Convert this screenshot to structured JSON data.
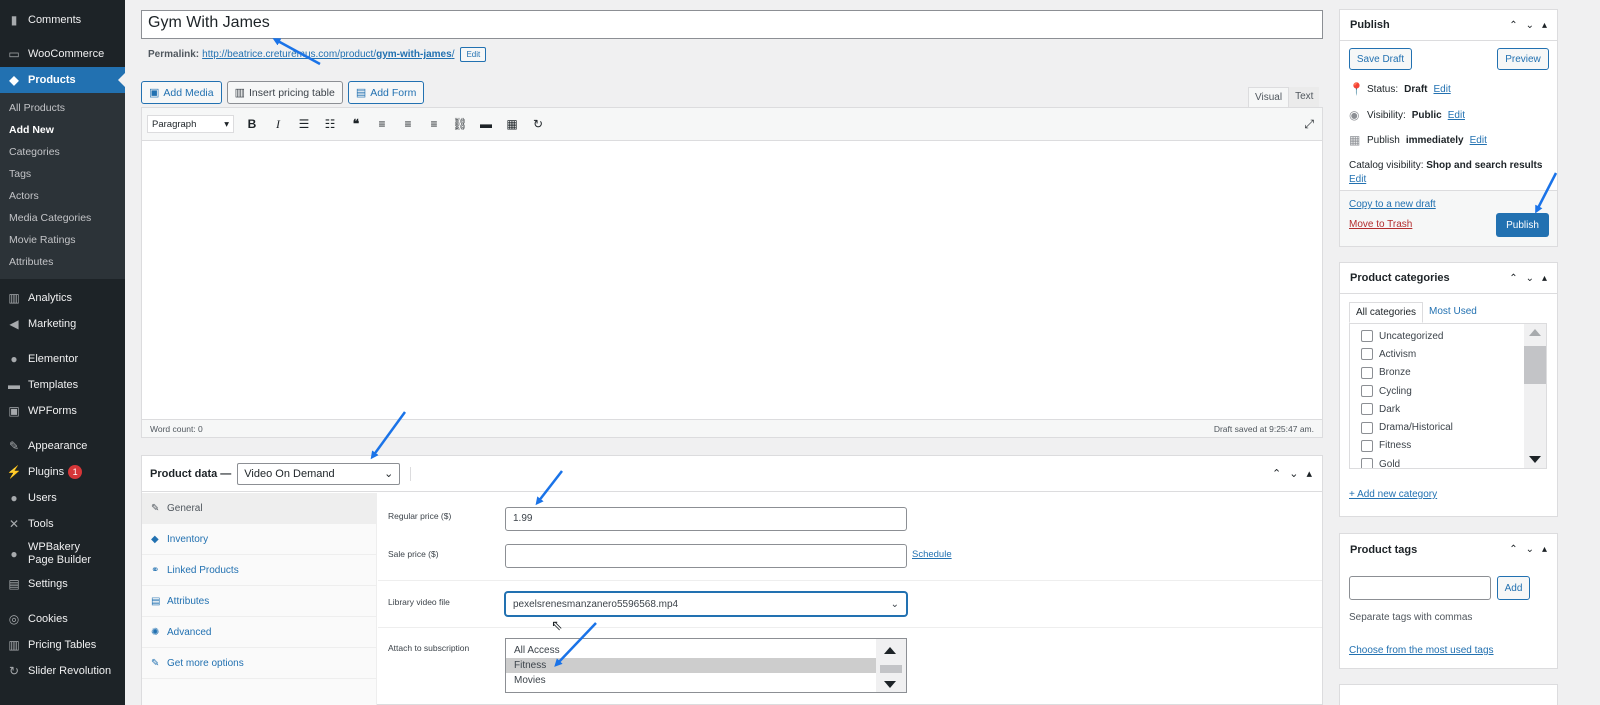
{
  "sidebar": {
    "items": [
      {
        "label": "Comments",
        "icon": "comment-icon"
      },
      {
        "label": "WooCommerce",
        "icon": "woo-icon"
      },
      {
        "label": "Products",
        "icon": "products-icon"
      }
    ],
    "products_submenu": [
      "All Products",
      "Add New",
      "Categories",
      "Tags",
      "Actors",
      "Media Categories",
      "Movie Ratings",
      "Attributes"
    ],
    "lower_items": [
      {
        "label": "Analytics"
      },
      {
        "label": "Marketing"
      },
      {
        "label": "Elementor"
      },
      {
        "label": "Templates"
      },
      {
        "label": "WPForms"
      },
      {
        "label": "Appearance"
      },
      {
        "label": "Plugins",
        "badge": "1"
      },
      {
        "label": "Users"
      },
      {
        "label": "Tools"
      },
      {
        "label": "WPBakery Page Builder"
      },
      {
        "label": "Settings"
      },
      {
        "label": "Cookies"
      },
      {
        "label": "Pricing Tables"
      },
      {
        "label": "Slider Revolution"
      }
    ]
  },
  "editor": {
    "title_value": "Gym With James",
    "permalink_label": "Permalink:",
    "permalink_base": "http://beatrice.creturemus.com/product/",
    "permalink_slug": "gym-with-james",
    "permalink_tail": "/",
    "permalink_edit": "Edit",
    "buttons": {
      "add_media": "Add Media",
      "insert_pricing": "Insert pricing table",
      "add_form": "Add Form"
    },
    "tabs": {
      "visual": "Visual",
      "text": "Text"
    },
    "format": "Paragraph",
    "word_count": "Word count: 0",
    "draft_saved": "Draft saved at 9:25:47 am."
  },
  "product_data": {
    "label": "Product data —",
    "type": "Video On Demand",
    "tabs": [
      "General",
      "Inventory",
      "Linked Products",
      "Attributes",
      "Advanced",
      "Get more options"
    ],
    "regular_price_label": "Regular price ($)",
    "regular_price": "1.99",
    "sale_price_label": "Sale price ($)",
    "sale_price": "",
    "schedule": "Schedule",
    "video_label": "Library video file",
    "video_file": "pexelsrenesmanzanero5596568.mp4",
    "subscription_label": "Attach to subscription",
    "subscription_options": [
      "All Access",
      "Fitness",
      "Movies"
    ],
    "selected_option": "Fitness"
  },
  "publish": {
    "title": "Publish",
    "save_draft": "Save Draft",
    "preview": "Preview",
    "status_label": "Status:",
    "status_value": "Draft",
    "visibility_label": "Visibility:",
    "visibility_value": "Public",
    "publish_label": "Publish",
    "publish_value": "immediately",
    "catalog_label": "Catalog visibility:",
    "catalog_value": "Shop and search results",
    "edit": "Edit",
    "copy_draft": "Copy to a new draft",
    "move_trash": "Move to Trash",
    "publish_button": "Publish"
  },
  "categories": {
    "title": "Product categories",
    "tab_all": "All categories",
    "tab_most": "Most Used",
    "items": [
      "Uncategorized",
      "Activism",
      "Bronze",
      "Cycling",
      "Dark",
      "Drama/Historical",
      "Fitness",
      "Gold"
    ],
    "add_new": "+ Add new category"
  },
  "tags": {
    "title": "Product tags",
    "add": "Add",
    "hint": "Separate tags with commas",
    "choose": "Choose from the most used tags"
  },
  "colors": {
    "accent": "#2271b1",
    "sidebar": "#1d2327",
    "annotation": "#1a73e8"
  }
}
